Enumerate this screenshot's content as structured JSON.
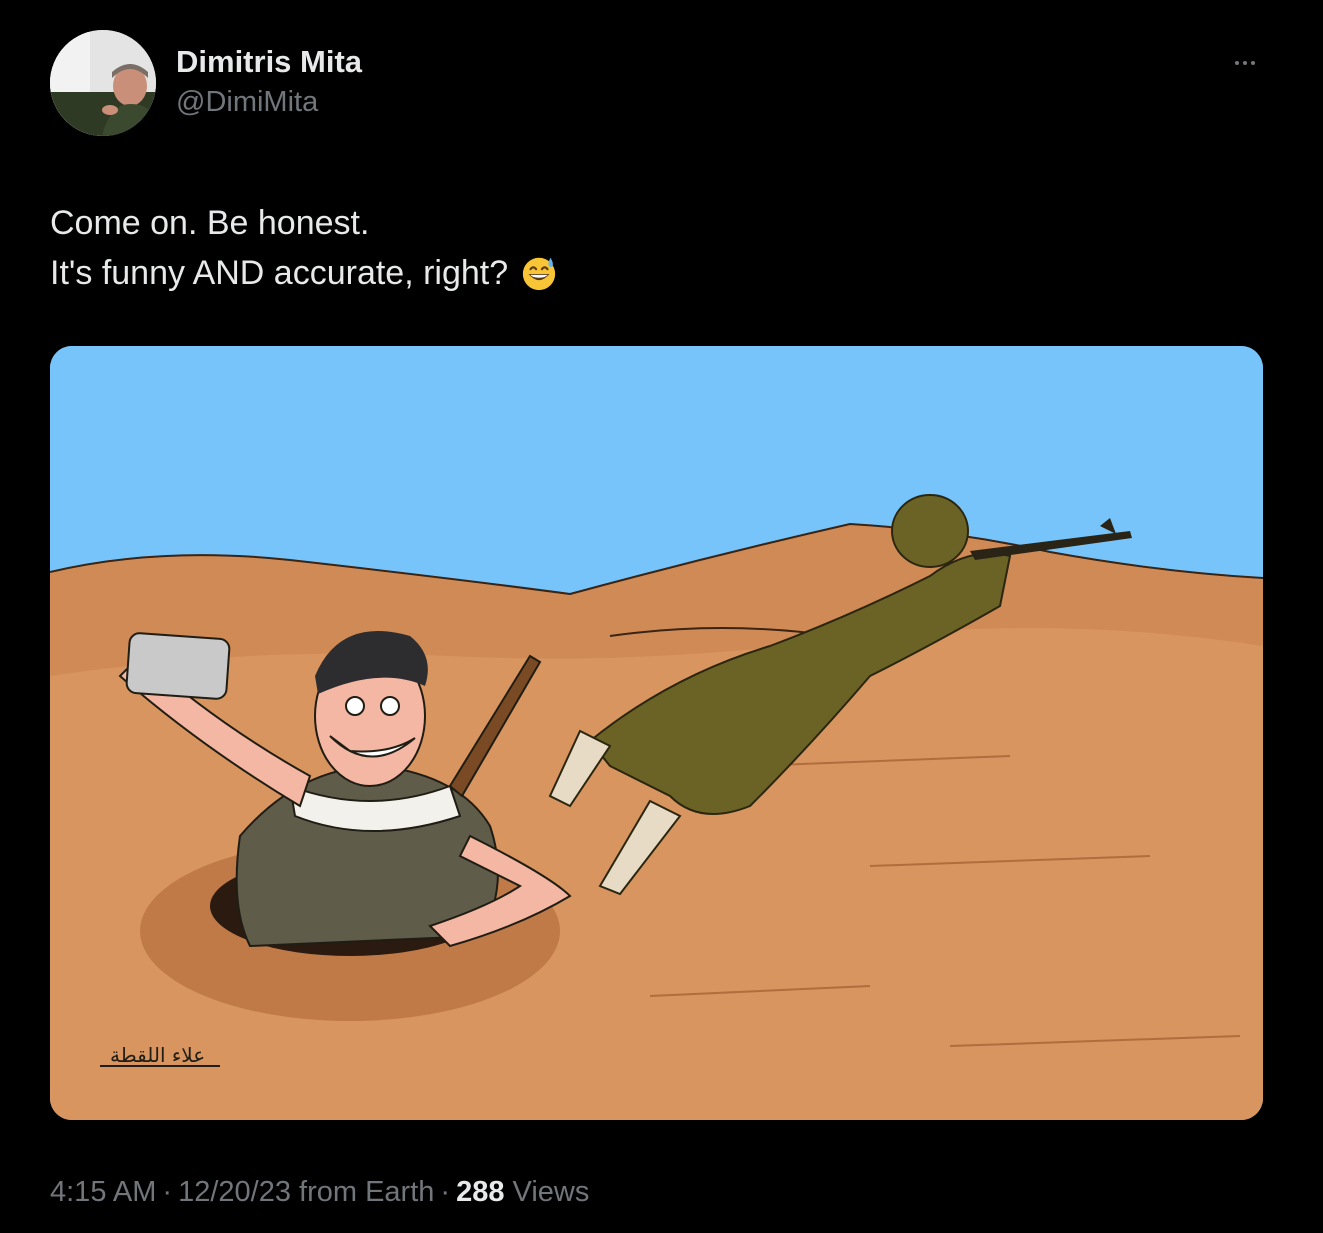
{
  "author": {
    "display_name": "Dimitris Mita",
    "handle": "@DimiMita",
    "avatar_icon": "user-photo-avatar"
  },
  "more_icon": "more-horizontal-icon",
  "tweet": {
    "lines": [
      "Come on. Be honest.",
      "It's funny AND accurate, right?"
    ],
    "emoji": "grinning-face-with-sweat-icon"
  },
  "media": {
    "description_icon": "cartoon-image",
    "signature": "علاء اللقطة"
  },
  "meta": {
    "time": "4:15 AM",
    "separator": "·",
    "date_source": "12/20/23 from Earth",
    "views_count": "288",
    "views_label": "Views"
  },
  "colors": {
    "background": "#000000",
    "primary_text": "#e7e9ea",
    "secondary_text": "#71767b",
    "sky": "#77c4fb",
    "sand": "#d48a55",
    "soldier": "#6b6225"
  }
}
